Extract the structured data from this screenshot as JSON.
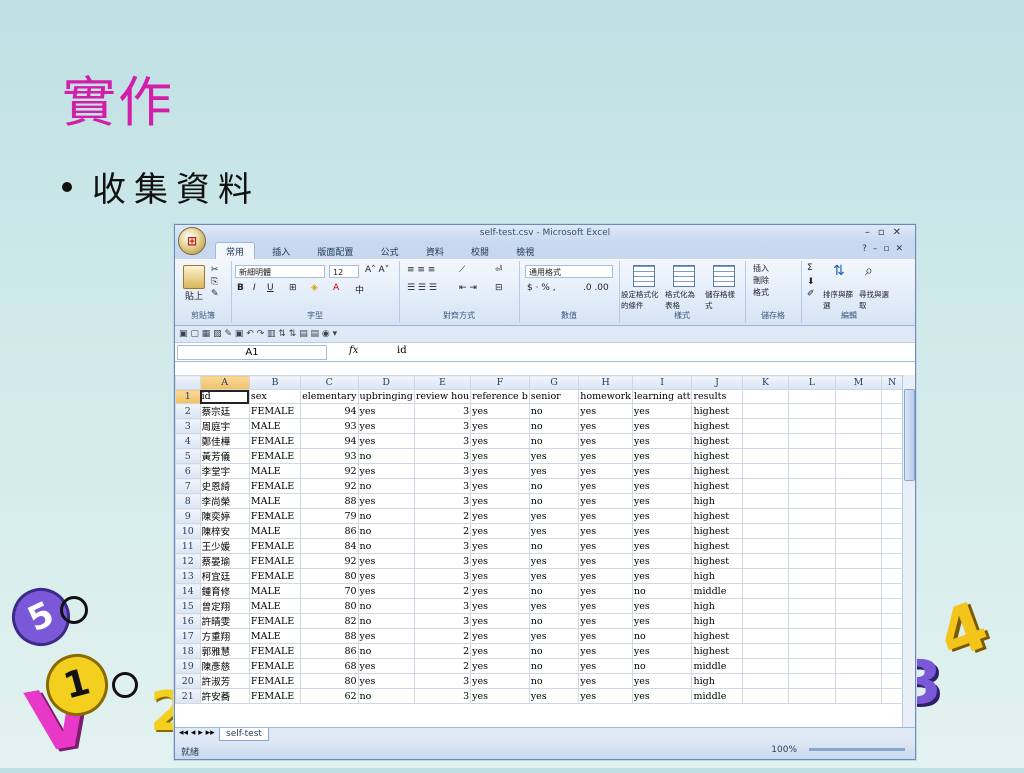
{
  "slide": {
    "title": "實作",
    "bullet": "收集資料",
    "deco": {
      "five": "5",
      "one": "1",
      "two": "2",
      "v": "V",
      "three": "3",
      "four": "4"
    }
  },
  "excel": {
    "title": "self-test.csv - Microsoft Excel",
    "office_button": "⊞",
    "tabs": [
      "常用",
      "插入",
      "版面配置",
      "公式",
      "資料",
      "校閱",
      "檢視"
    ],
    "active_tab": "常用",
    "ribbon": {
      "paste_label": "貼上",
      "font_name": "新細明體",
      "font_size": "12",
      "number_format": "通用格式",
      "groups": {
        "clipboard": "剪貼簿",
        "font": "字型",
        "alignment": "對齊方式",
        "number": "數值",
        "styles": "樣式",
        "cells": "儲存格",
        "editing": "編輯"
      },
      "styles_buttons": [
        "設定格式化的條件",
        "格式化為表格",
        "儲存格樣式"
      ],
      "cells_buttons": [
        "插入",
        "刪除",
        "格式"
      ],
      "editing_buttons": [
        "排序與篩選",
        "尋找與選取"
      ]
    },
    "name_box": "A1",
    "formula_value": "id",
    "columns": [
      "A",
      "B",
      "C",
      "D",
      "E",
      "F",
      "G",
      "H",
      "I",
      "J",
      "K",
      "L",
      "M",
      "N"
    ],
    "header_row": [
      "id",
      "sex",
      "elementary",
      "upbringing",
      "review hou",
      "reference b",
      "senior",
      "homework",
      "learning att",
      "results"
    ],
    "rows": [
      [
        "蔡宗廷",
        "FEMALE",
        "94",
        "yes",
        "3",
        "yes",
        "no",
        "yes",
        "yes",
        "highest"
      ],
      [
        "周庭宇",
        "MALE",
        "93",
        "yes",
        "3",
        "yes",
        "no",
        "yes",
        "yes",
        "highest"
      ],
      [
        "鄭佳樺",
        "FEMALE",
        "94",
        "yes",
        "3",
        "yes",
        "no",
        "yes",
        "yes",
        "highest"
      ],
      [
        "黃芳儀",
        "FEMALE",
        "93",
        "no",
        "3",
        "yes",
        "yes",
        "yes",
        "yes",
        "highest"
      ],
      [
        "李堂宇",
        "MALE",
        "92",
        "yes",
        "3",
        "yes",
        "yes",
        "yes",
        "yes",
        "highest"
      ],
      [
        "史恩綺",
        "FEMALE",
        "92",
        "no",
        "3",
        "yes",
        "no",
        "yes",
        "yes",
        "highest"
      ],
      [
        "李尚榮",
        "MALE",
        "88",
        "yes",
        "3",
        "yes",
        "no",
        "yes",
        "yes",
        "high"
      ],
      [
        "陳奕婷",
        "FEMALE",
        "79",
        "no",
        "2",
        "yes",
        "yes",
        "yes",
        "yes",
        "highest"
      ],
      [
        "陳梓安",
        "MALE",
        "86",
        "no",
        "2",
        "yes",
        "yes",
        "yes",
        "yes",
        "highest"
      ],
      [
        "王少媛",
        "FEMALE",
        "84",
        "no",
        "3",
        "yes",
        "no",
        "yes",
        "yes",
        "highest"
      ],
      [
        "蔡晏瑜",
        "FEMALE",
        "92",
        "yes",
        "3",
        "yes",
        "yes",
        "yes",
        "yes",
        "highest"
      ],
      [
        "柯宜廷",
        "FEMALE",
        "80",
        "yes",
        "3",
        "yes",
        "yes",
        "yes",
        "yes",
        "high"
      ],
      [
        "鍾育修",
        "MALE",
        "70",
        "yes",
        "2",
        "yes",
        "no",
        "yes",
        "no",
        "middle"
      ],
      [
        "曾定翔",
        "MALE",
        "80",
        "no",
        "3",
        "yes",
        "yes",
        "yes",
        "yes",
        "high"
      ],
      [
        "許晴雯",
        "FEMALE",
        "82",
        "no",
        "3",
        "yes",
        "no",
        "yes",
        "yes",
        "high"
      ],
      [
        "方重翔",
        "MALE",
        "88",
        "yes",
        "2",
        "yes",
        "yes",
        "yes",
        "no",
        "highest"
      ],
      [
        "郭雅慧",
        "FEMALE",
        "86",
        "no",
        "2",
        "yes",
        "no",
        "yes",
        "yes",
        "highest"
      ],
      [
        "陳彥慈",
        "FEMALE",
        "68",
        "yes",
        "2",
        "yes",
        "no",
        "yes",
        "no",
        "middle"
      ],
      [
        "許淑芳",
        "FEMALE",
        "80",
        "yes",
        "3",
        "yes",
        "no",
        "yes",
        "yes",
        "high"
      ],
      [
        "許安蕎",
        "FEMALE",
        "62",
        "no",
        "3",
        "yes",
        "yes",
        "yes",
        "yes",
        "middle"
      ]
    ],
    "sheet_tab": "self-test",
    "status": "就緒",
    "zoom": "100%"
  }
}
